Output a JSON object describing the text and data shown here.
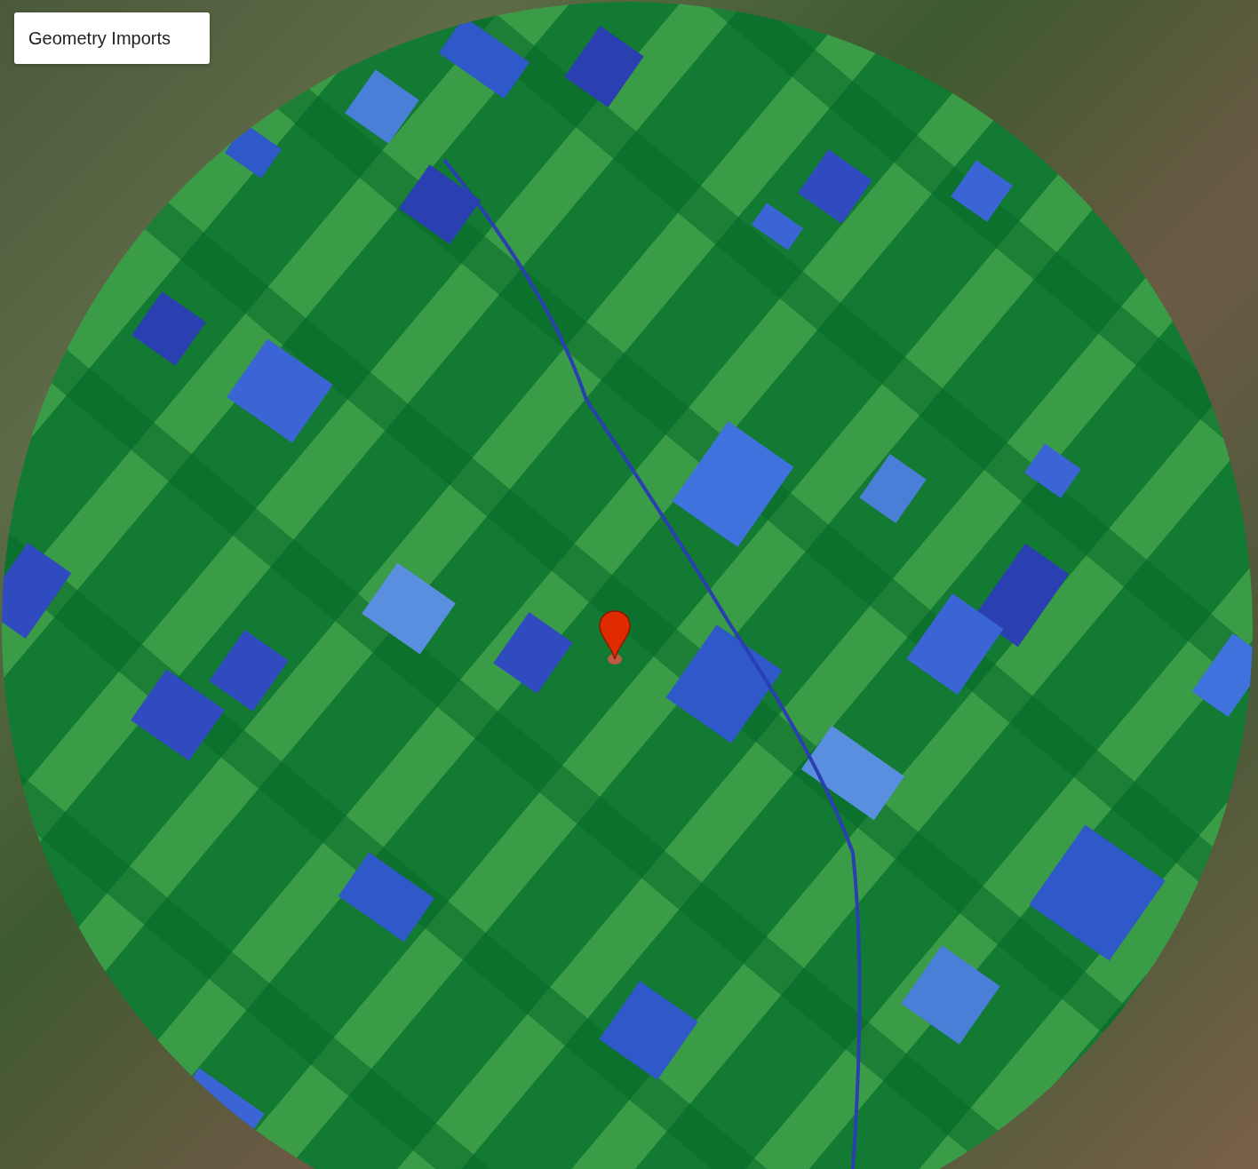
{
  "map": {
    "geometry_imports_button": {
      "label": "Geometry Imports"
    }
  }
}
